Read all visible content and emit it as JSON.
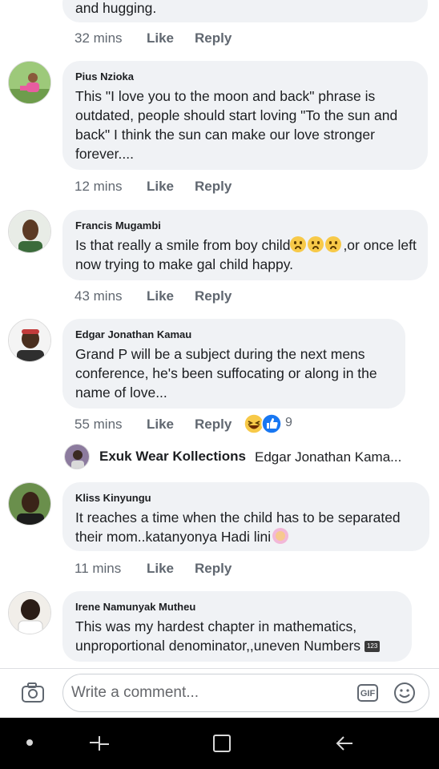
{
  "comments": [
    {
      "name": "",
      "text": "and hugging.",
      "time": "32 mins"
    },
    {
      "name": "Pius Nzioka",
      "text": "This \"I love you to the moon and back\" phrase is outdated, people should start loving \"To the sun and back\" I think the sun can make our love stronger forever....",
      "time": "12 mins"
    },
    {
      "name": "Francis Mugambi",
      "text_before": "Is that really a smile from boy child",
      "text_after": ",or once left now trying to make gal child happy.",
      "time": "43 mins"
    },
    {
      "name": "Edgar Jonathan Kamau",
      "text": "Grand P will be a subject during the next mens conference, he's been suffocating or along in the name of love...",
      "time": "55 mins",
      "reaction_count": "9"
    },
    {
      "name": "Kliss Kinyungu",
      "text": "It reaches a time when the child has to be separated their mom..katanyonya Hadi lini",
      "time": "11 mins"
    },
    {
      "name": "Irene Namunyak Mutheu",
      "text": "This was my hardest chapter in mathematics, unproportional denominator,,uneven Numbers",
      "badge": "123"
    }
  ],
  "actions": {
    "like": "Like",
    "reply": "Reply"
  },
  "reply_preview": {
    "author": "Exuk Wear Kollections",
    "snippet": "Edgar Jonathan Kama..."
  },
  "composer": {
    "placeholder": "Write a comment...",
    "gif_label": "GIF"
  },
  "icons": {
    "camera": "camera-icon",
    "gif": "gif-icon",
    "emoji": "smiley-icon",
    "nav_dot": "home-dot-icon",
    "recents": "recents-icon",
    "square": "overview-icon",
    "back": "back-icon",
    "haha": "haha-reaction-icon",
    "like_reaction": "like-reaction-icon"
  },
  "colors": {
    "bubble": "#f0f2f5",
    "meta": "#606770",
    "like_blue": "#1877f2",
    "haha_yellow": "#f7c948"
  }
}
